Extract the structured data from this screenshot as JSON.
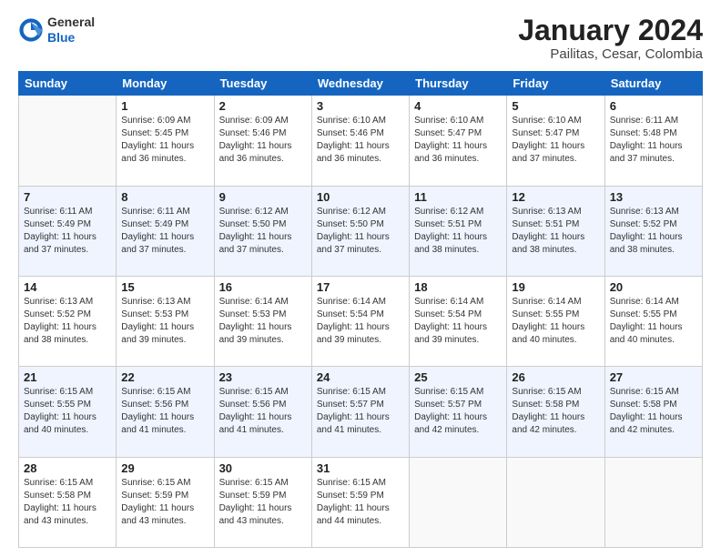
{
  "header": {
    "logo_general": "General",
    "logo_blue": "Blue",
    "title": "January 2024",
    "subtitle": "Pailitas, Cesar, Colombia"
  },
  "days_of_week": [
    "Sunday",
    "Monday",
    "Tuesday",
    "Wednesday",
    "Thursday",
    "Friday",
    "Saturday"
  ],
  "weeks": [
    [
      {
        "day": "",
        "info": ""
      },
      {
        "day": "1",
        "info": "Sunrise: 6:09 AM\nSunset: 5:45 PM\nDaylight: 11 hours\nand 36 minutes."
      },
      {
        "day": "2",
        "info": "Sunrise: 6:09 AM\nSunset: 5:46 PM\nDaylight: 11 hours\nand 36 minutes."
      },
      {
        "day": "3",
        "info": "Sunrise: 6:10 AM\nSunset: 5:46 PM\nDaylight: 11 hours\nand 36 minutes."
      },
      {
        "day": "4",
        "info": "Sunrise: 6:10 AM\nSunset: 5:47 PM\nDaylight: 11 hours\nand 36 minutes."
      },
      {
        "day": "5",
        "info": "Sunrise: 6:10 AM\nSunset: 5:47 PM\nDaylight: 11 hours\nand 37 minutes."
      },
      {
        "day": "6",
        "info": "Sunrise: 6:11 AM\nSunset: 5:48 PM\nDaylight: 11 hours\nand 37 minutes."
      }
    ],
    [
      {
        "day": "7",
        "info": "Sunrise: 6:11 AM\nSunset: 5:49 PM\nDaylight: 11 hours\nand 37 minutes."
      },
      {
        "day": "8",
        "info": "Sunrise: 6:11 AM\nSunset: 5:49 PM\nDaylight: 11 hours\nand 37 minutes."
      },
      {
        "day": "9",
        "info": "Sunrise: 6:12 AM\nSunset: 5:50 PM\nDaylight: 11 hours\nand 37 minutes."
      },
      {
        "day": "10",
        "info": "Sunrise: 6:12 AM\nSunset: 5:50 PM\nDaylight: 11 hours\nand 37 minutes."
      },
      {
        "day": "11",
        "info": "Sunrise: 6:12 AM\nSunset: 5:51 PM\nDaylight: 11 hours\nand 38 minutes."
      },
      {
        "day": "12",
        "info": "Sunrise: 6:13 AM\nSunset: 5:51 PM\nDaylight: 11 hours\nand 38 minutes."
      },
      {
        "day": "13",
        "info": "Sunrise: 6:13 AM\nSunset: 5:52 PM\nDaylight: 11 hours\nand 38 minutes."
      }
    ],
    [
      {
        "day": "14",
        "info": "Sunrise: 6:13 AM\nSunset: 5:52 PM\nDaylight: 11 hours\nand 38 minutes."
      },
      {
        "day": "15",
        "info": "Sunrise: 6:13 AM\nSunset: 5:53 PM\nDaylight: 11 hours\nand 39 minutes."
      },
      {
        "day": "16",
        "info": "Sunrise: 6:14 AM\nSunset: 5:53 PM\nDaylight: 11 hours\nand 39 minutes."
      },
      {
        "day": "17",
        "info": "Sunrise: 6:14 AM\nSunset: 5:54 PM\nDaylight: 11 hours\nand 39 minutes."
      },
      {
        "day": "18",
        "info": "Sunrise: 6:14 AM\nSunset: 5:54 PM\nDaylight: 11 hours\nand 39 minutes."
      },
      {
        "day": "19",
        "info": "Sunrise: 6:14 AM\nSunset: 5:55 PM\nDaylight: 11 hours\nand 40 minutes."
      },
      {
        "day": "20",
        "info": "Sunrise: 6:14 AM\nSunset: 5:55 PM\nDaylight: 11 hours\nand 40 minutes."
      }
    ],
    [
      {
        "day": "21",
        "info": "Sunrise: 6:15 AM\nSunset: 5:55 PM\nDaylight: 11 hours\nand 40 minutes."
      },
      {
        "day": "22",
        "info": "Sunrise: 6:15 AM\nSunset: 5:56 PM\nDaylight: 11 hours\nand 41 minutes."
      },
      {
        "day": "23",
        "info": "Sunrise: 6:15 AM\nSunset: 5:56 PM\nDaylight: 11 hours\nand 41 minutes."
      },
      {
        "day": "24",
        "info": "Sunrise: 6:15 AM\nSunset: 5:57 PM\nDaylight: 11 hours\nand 41 minutes."
      },
      {
        "day": "25",
        "info": "Sunrise: 6:15 AM\nSunset: 5:57 PM\nDaylight: 11 hours\nand 42 minutes."
      },
      {
        "day": "26",
        "info": "Sunrise: 6:15 AM\nSunset: 5:58 PM\nDaylight: 11 hours\nand 42 minutes."
      },
      {
        "day": "27",
        "info": "Sunrise: 6:15 AM\nSunset: 5:58 PM\nDaylight: 11 hours\nand 42 minutes."
      }
    ],
    [
      {
        "day": "28",
        "info": "Sunrise: 6:15 AM\nSunset: 5:58 PM\nDaylight: 11 hours\nand 43 minutes."
      },
      {
        "day": "29",
        "info": "Sunrise: 6:15 AM\nSunset: 5:59 PM\nDaylight: 11 hours\nand 43 minutes."
      },
      {
        "day": "30",
        "info": "Sunrise: 6:15 AM\nSunset: 5:59 PM\nDaylight: 11 hours\nand 43 minutes."
      },
      {
        "day": "31",
        "info": "Sunrise: 6:15 AM\nSunset: 5:59 PM\nDaylight: 11 hours\nand 44 minutes."
      },
      {
        "day": "",
        "info": ""
      },
      {
        "day": "",
        "info": ""
      },
      {
        "day": "",
        "info": ""
      }
    ]
  ]
}
